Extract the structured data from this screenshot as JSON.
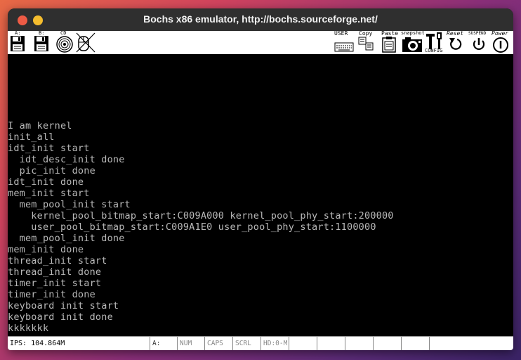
{
  "window": {
    "title": "Bochs x86 emulator, http://bochs.sourceforge.net/"
  },
  "toolbar": {
    "floppy_a_label": "A:",
    "floppy_b_label": "B:",
    "cdrom_label": "CD",
    "user_label": "USER",
    "copy_label": "Copy",
    "paste_label": "Paste",
    "snapshot_label": "snapshot",
    "config_label": "CONFIG",
    "reset_label": "Reset",
    "suspend_label": "SUSPEND",
    "power_label": "Power"
  },
  "console": {
    "lines": [
      "I am kernel",
      "init_all",
      "idt_init start",
      "  idt_desc_init done",
      "  pic_init done",
      "idt_init done",
      "mem_init start",
      "  mem_pool_init start",
      "    kernel_pool_bitmap_start:C009A000 kernel_pool_phy_start:200000",
      "    user_pool_bitmap_start:C009A1E0 user_pool_phy_start:1100000",
      "  mem_pool_init done",
      "mem_init done",
      "thread_init start",
      "thread_init done",
      "timer_init start",
      "timer_init done",
      "keyboard init start",
      "keyboard init done",
      "kkkkkkk"
    ]
  },
  "statusbar": {
    "ips": "IPS: 104.864M",
    "drive_a": "A:",
    "num": "NUM",
    "caps": "CAPS",
    "scrl": "SCRL",
    "hd": "HD:0-M"
  },
  "colors": {
    "titlebar": "#2f2f2f",
    "close_button": "#ee5b45",
    "minimize_button": "#f5bd2e",
    "console_text": "#b8b8b8",
    "console_bg": "#000000"
  }
}
